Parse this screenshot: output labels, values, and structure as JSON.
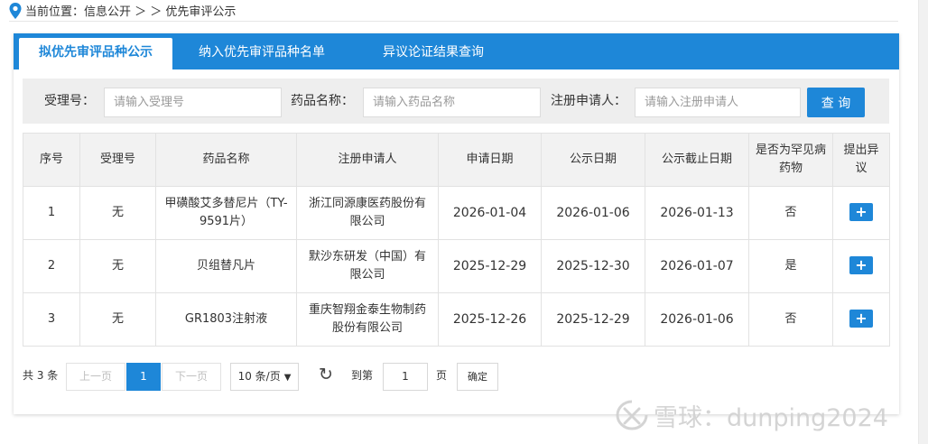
{
  "breadcrumb": {
    "icon": "location-pin-icon",
    "text": "当前位置：信息公开 ＞ ＞ 优先审评公示"
  },
  "tabs": [
    {
      "label": "拟优先审评品种公示",
      "active": true
    },
    {
      "label": "纳入优先审评品种名单",
      "active": false
    },
    {
      "label": "异议论证结果查询",
      "active": false
    }
  ],
  "search": {
    "accept_no_label": "受理号：",
    "accept_no_placeholder": "请输入受理号",
    "drug_name_label": "药品名称：",
    "drug_name_placeholder": "请输入药品名称",
    "applicant_label": "注册申请人：",
    "applicant_placeholder": "请输入注册申请人",
    "query_button": "查 询"
  },
  "table": {
    "headers": [
      "序号",
      "受理号",
      "药品名称",
      "注册申请人",
      "申请日期",
      "公示日期",
      "公示截止日期",
      "是否为罕见病药物",
      "提出异议"
    ],
    "rows": [
      {
        "index": "1",
        "accept_no": "无",
        "drug_name": "甲磺酸艾多替尼片（TY-9591片）",
        "applicant": "浙江同源康医药股份有限公司",
        "apply_date": "2026-01-04",
        "publish_date": "2026-01-06",
        "deadline": "2026-01-13",
        "rare_disease": "否",
        "objection": "+"
      },
      {
        "index": "2",
        "accept_no": "无",
        "drug_name": "贝组替凡片",
        "applicant": "默沙东研发（中国）有限公司",
        "apply_date": "2025-12-29",
        "publish_date": "2025-12-30",
        "deadline": "2026-01-07",
        "rare_disease": "是",
        "objection": "+"
      },
      {
        "index": "3",
        "accept_no": "无",
        "drug_name": "GR1803注射液",
        "applicant": "重庆智翔金泰生物制药股份有限公司",
        "apply_date": "2025-12-26",
        "publish_date": "2025-12-29",
        "deadline": "2026-01-06",
        "rare_disease": "否",
        "objection": "+"
      }
    ]
  },
  "pager": {
    "total": "共 3 条",
    "prev": "上一页",
    "current_page": "1",
    "next": "下一页",
    "page_size": "10 条/页",
    "refresh_icon": "refresh-icon",
    "goto_label": "到第",
    "goto_value": "1",
    "page_word": "页",
    "confirm": "确定"
  },
  "watermark": {
    "text": "雪球：dunping2024"
  },
  "colors": {
    "accent": "#1e87d8",
    "header_bg": "#f2f2f2",
    "search_bg": "#eeeeee"
  }
}
